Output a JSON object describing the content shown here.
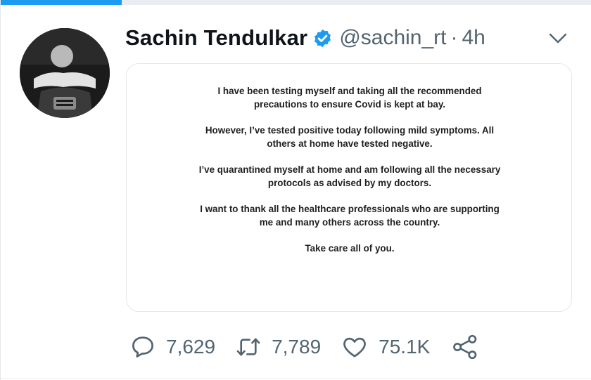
{
  "progress": {
    "fraction": 0.205
  },
  "tweet": {
    "author": {
      "display_name": "Sachin Tendulkar",
      "handle": "@sachin_rt",
      "separator": "·",
      "time": "4h",
      "verified": true
    },
    "image_text": {
      "paragraphs": [
        "I have been testing myself and taking all the recommended precautions to ensure Covid is kept at bay.",
        "However, I’ve tested positive today following mild symptoms. All others at home have tested negative.",
        "I’ve quarantined myself at home and am following all the necessary protocols as advised by my doctors.",
        "I want to thank all the healthcare professionals who are supporting me and many others across the country.",
        "Take care all of you."
      ]
    },
    "stats": {
      "replies": "7,629",
      "retweets": "7,789",
      "likes": "75.1K"
    }
  },
  "colors": {
    "accent": "#1d9bf0",
    "secondary_text": "#536471"
  },
  "icons": {
    "verified": "verified-badge-icon",
    "caret": "chevron-down-icon",
    "reply": "reply-icon",
    "retweet": "retweet-icon",
    "like": "heart-icon",
    "share": "share-icon"
  }
}
